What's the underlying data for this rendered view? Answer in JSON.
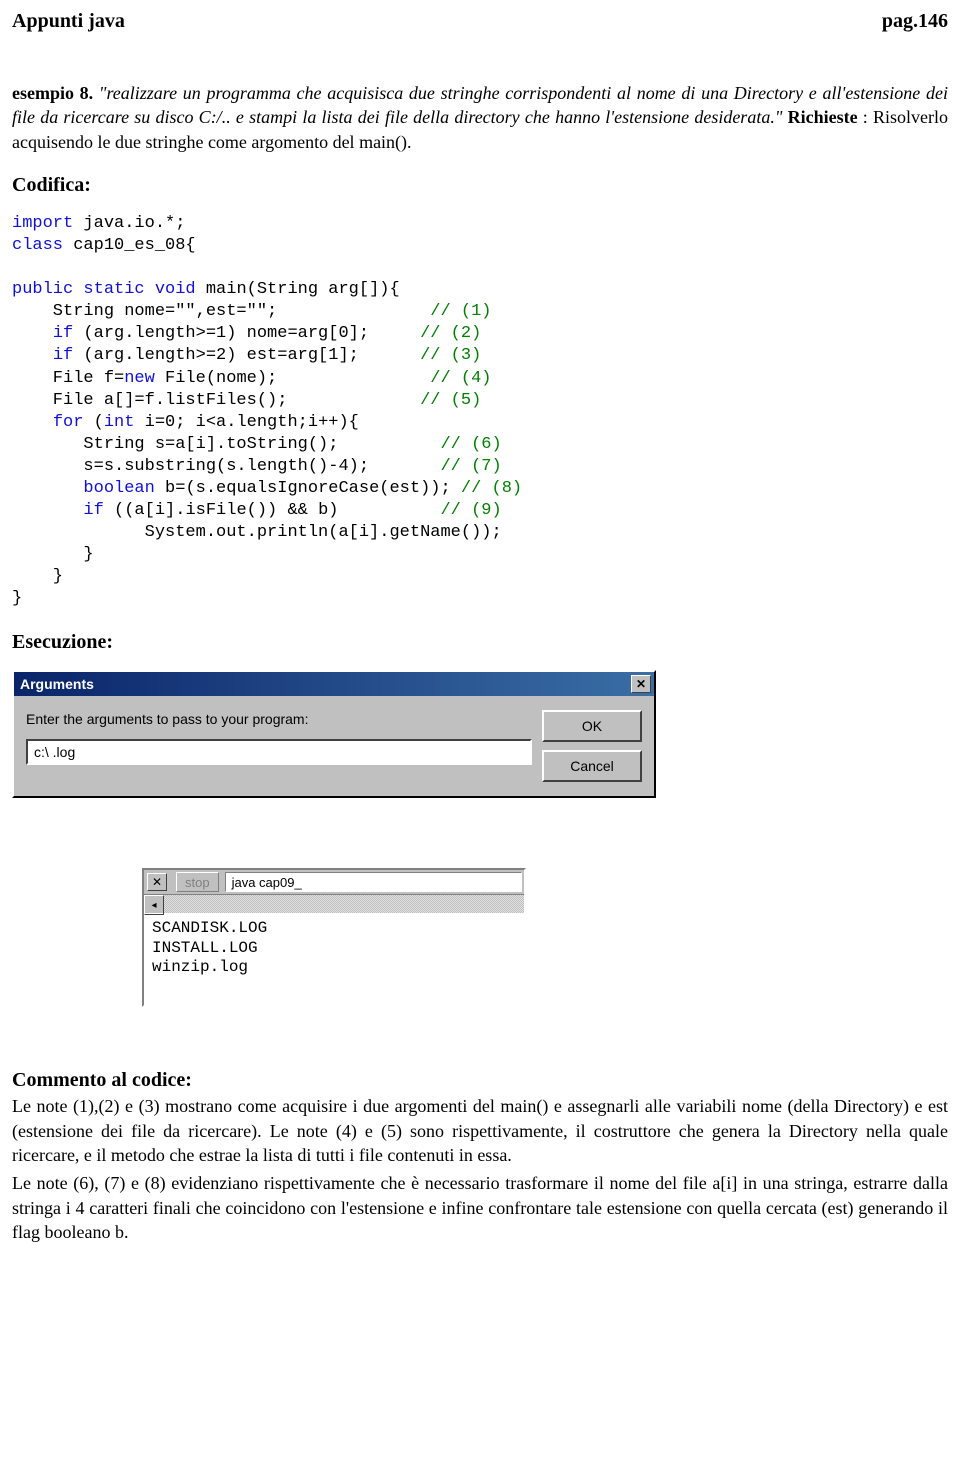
{
  "header": {
    "left": "Appunti java",
    "right": "pag.146"
  },
  "intro": {
    "ex_label": "esempio 8.",
    "italic": " \"realizzare un programma che acquisisca due stringhe corrispondenti al nome di una Directory e all'estensione dei file da ricercare su disco C:/.. e stampi la lista dei file della directory che hanno l'estensione desiderata.\" ",
    "richieste_label": "Richieste",
    "richieste_text": ": Risolverlo acquisendo le due stringhe come argomento del main()."
  },
  "sections": {
    "codifica": "Codifica:",
    "esecuzione": "Esecuzione:",
    "commento": "Commento al codice:"
  },
  "code": {
    "l1a": "import",
    "l1b": " java.io.*;",
    "l2a": "class",
    "l2b": " cap10_es_08{",
    "l3a": "public static void",
    "l3b": " main(String arg[]){",
    "l4": "    String nome=\"\",est=\"\";               ",
    "c4": "// (1)",
    "l5a": "    ",
    "l5kw": "if",
    "l5b": " (arg.length>=1) nome=arg[0];     ",
    "c5": "// (2)",
    "l6a": "    ",
    "l6kw": "if",
    "l6b": " (arg.length>=2) est=arg[1];      ",
    "c6": "// (3)",
    "l7a": "    File f=",
    "l7kw": "new",
    "l7b": " File(nome);               ",
    "c7": "// (4)",
    "l8": "    File a[]=f.listFiles();             ",
    "c8": "// (5)",
    "l9a": "    ",
    "l9kw": "for",
    "l9b": " (",
    "l9kw2": "int",
    "l9c": " i=0; i<a.length;i++){",
    "l10": "       String s=a[i].toString();          ",
    "c10": "// (6)",
    "l11": "       s=s.substring(s.length()-4);       ",
    "c11": "// (7)",
    "l12a": "       ",
    "l12kw": "boolean",
    "l12b": " b=(s.equalsIgnoreCase(est));",
    "c12": "// (8)",
    "l13a": "       ",
    "l13kw": "if",
    "l13b": " ((a[i].isFile()) && b)          ",
    "c13": "// (9)",
    "l14": "             System.out.println(a[i].getName());",
    "l15": "       }",
    "l16": "    }",
    "l17": "}"
  },
  "dialog": {
    "title": "Arguments",
    "close_x": "✕",
    "prompt": "Enter the arguments to pass to your program:",
    "input_value": "c:\\ .log",
    "ok": "OK",
    "cancel": "Cancel"
  },
  "output": {
    "close_x": "✕",
    "stop": "stop",
    "cmd": "java cap09_",
    "arrow_left": "◂",
    "lines": "SCANDISK.LOG\nINSTALL.LOG\nwinzip.log"
  },
  "commento": {
    "p1": "Le note (1),(2) e (3) mostrano come acquisire i due argomenti del main() e assegnarli alle variabili nome (della Directory) e est (estensione dei file da ricercare). Le note (4) e (5) sono rispettivamente, il costruttore che genera la Directory nella quale ricercare, e il metodo che estrae la lista di tutti i file contenuti in essa.",
    "p2": "Le note (6), (7) e (8) evidenziano rispettivamente che è necessario trasformare il nome del file a[i] in una stringa, estrarre dalla stringa i 4 caratteri finali che coincidono con l'estensione e infine confrontare tale estensione con quella cercata (est) generando il flag booleano b."
  }
}
